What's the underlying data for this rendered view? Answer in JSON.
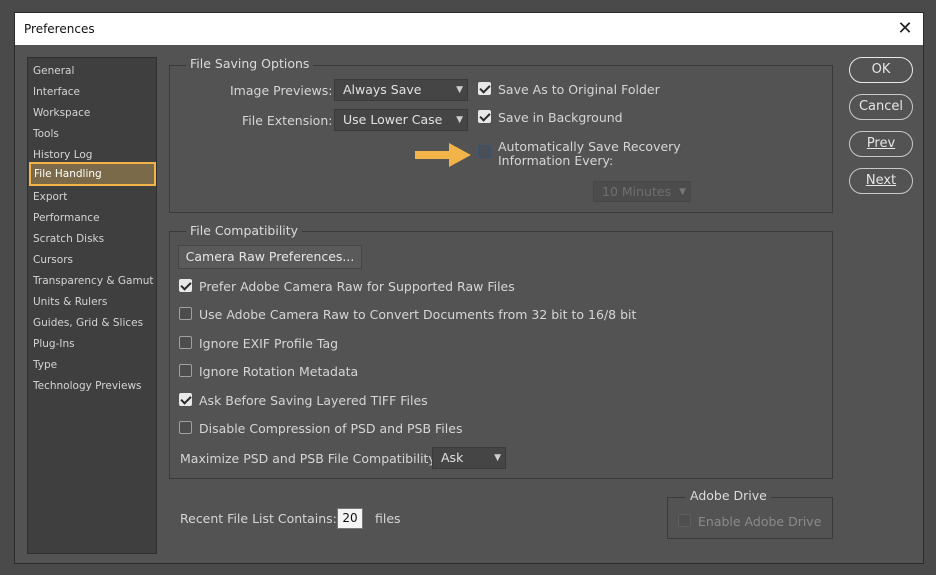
{
  "window": {
    "title": "Preferences"
  },
  "sidebar": {
    "items": [
      {
        "label": "General"
      },
      {
        "label": "Interface"
      },
      {
        "label": "Workspace"
      },
      {
        "label": "Tools"
      },
      {
        "label": "History Log"
      },
      {
        "label": "File Handling",
        "active": true
      },
      {
        "label": "Export"
      },
      {
        "label": "Performance"
      },
      {
        "label": "Scratch Disks"
      },
      {
        "label": "Cursors"
      },
      {
        "label": "Transparency & Gamut"
      },
      {
        "label": "Units & Rulers"
      },
      {
        "label": "Guides, Grid & Slices"
      },
      {
        "label": "Plug-Ins"
      },
      {
        "label": "Type"
      },
      {
        "label": "Technology Previews"
      }
    ]
  },
  "file_saving": {
    "title": "File Saving Options",
    "image_previews_label": "Image Previews:",
    "image_previews_value": "Always Save",
    "file_extension_label": "File Extension:",
    "file_extension_value": "Use Lower Case",
    "save_original_folder": {
      "label": "Save As to Original Folder",
      "checked": true
    },
    "save_background": {
      "label": "Save in Background",
      "checked": true
    },
    "auto_save": {
      "label_line1": "Automatically Save Recovery",
      "label_line2": "Information Every:",
      "checked": false
    },
    "interval_value": "10 Minutes",
    "pointer_color": "#f2b349"
  },
  "compatibility": {
    "title": "File Compatibility",
    "camera_raw_button": "Camera Raw Preferences...",
    "options": [
      {
        "label": "Prefer Adobe Camera Raw for Supported Raw Files",
        "checked": true
      },
      {
        "label": "Use Adobe Camera Raw to Convert Documents from 32 bit to 16/8 bit",
        "checked": false
      },
      {
        "label": "Ignore EXIF Profile Tag",
        "checked": false
      },
      {
        "label": "Ignore Rotation Metadata",
        "checked": false
      },
      {
        "label": "Ask Before Saving Layered TIFF Files",
        "checked": true
      },
      {
        "label": "Disable Compression of PSD and PSB Files",
        "checked": false
      }
    ],
    "maximize_label": "Maximize PSD and PSB File Compatibility:",
    "maximize_value": "Ask"
  },
  "recent": {
    "label": "Recent File List Contains:",
    "value": "20",
    "unit": "files"
  },
  "adobe_drive": {
    "title": "Adobe Drive",
    "enable_label": "Enable Adobe Drive",
    "checked": false
  },
  "buttons": {
    "ok": "OK",
    "cancel": "Cancel",
    "prev": "Prev",
    "next": "Next"
  }
}
